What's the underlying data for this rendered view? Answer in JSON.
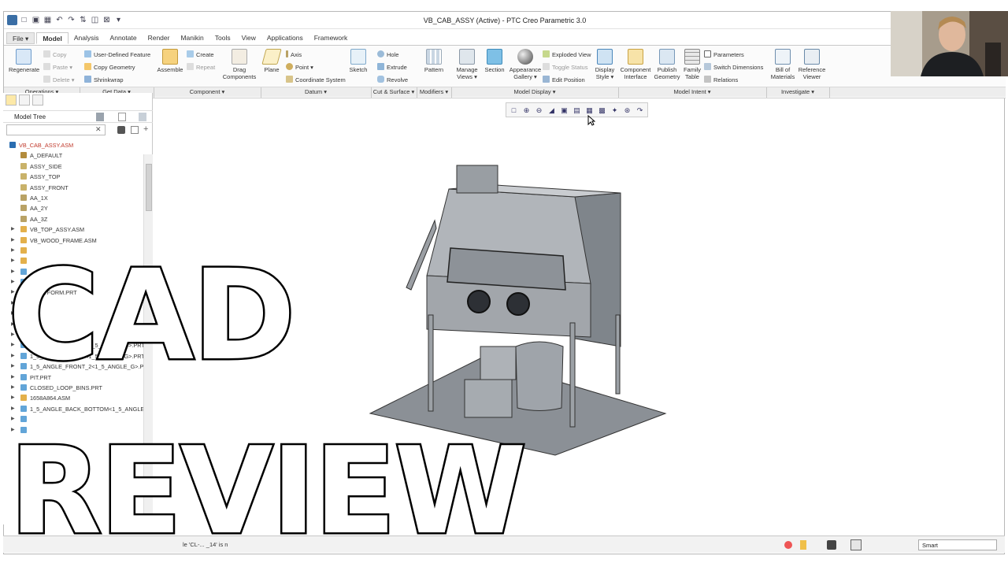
{
  "window": {
    "title": "VB_CAB_ASSY (Active) - PTC Creo Parametric 3.0"
  },
  "tabs": [
    {
      "label": "File ▾"
    },
    {
      "label": "Model"
    },
    {
      "label": "Analysis"
    },
    {
      "label": "Annotate"
    },
    {
      "label": "Render"
    },
    {
      "label": "Manikin"
    },
    {
      "label": "Tools"
    },
    {
      "label": "View"
    },
    {
      "label": "Applications"
    },
    {
      "label": "Framework"
    }
  ],
  "ribbon": {
    "regenerate": "Regenerate",
    "copy": "Copy",
    "paste": "Paste ▾",
    "delete": "Delete ▾",
    "user_defined_feature": "User-Defined Feature",
    "copy_geometry": "Copy Geometry",
    "shrinkwrap": "Shrinkwrap",
    "assemble": "Assemble",
    "create": "Create",
    "repeat": "Repeat",
    "drag_components_1": "Drag",
    "drag_components_2": "Components",
    "plane": "Plane",
    "axis": "Axis",
    "point": "Point ▾",
    "coordinate_system": "Coordinate System",
    "sketch": "Sketch",
    "hole": "Hole",
    "extrude": "Extrude",
    "revolve": "Revolve",
    "pattern": "Pattern",
    "manage_views_1": "Manage",
    "manage_views_2": "Views ▾",
    "section": "Section",
    "appearance_gallery_1": "Appearance",
    "appearance_gallery_2": "Gallery ▾",
    "exploded_view": "Exploded View",
    "toggle_status": "Toggle Status",
    "edit_position": "Edit Position",
    "display_style_1": "Display",
    "display_style_2": "Style ▾",
    "component_interface_1": "Component",
    "component_interface_2": "Interface",
    "publish_geometry_1": "Publish",
    "publish_geometry_2": "Geometry",
    "family_table_1": "Family",
    "family_table_2": "Table",
    "parameters": "Parameters",
    "switch_dimensions": "Switch Dimensions",
    "relations": "Relations",
    "bill_of_materials_1": "Bill of",
    "bill_of_materials_2": "Materials",
    "reference_viewer_1": "Reference",
    "reference_viewer_2": "Viewer"
  },
  "groups": [
    {
      "label": "Operations ▾"
    },
    {
      "label": "Get Data ▾"
    },
    {
      "label": "Component ▾"
    },
    {
      "label": "Datum ▾"
    },
    {
      "label": "Cut & Surface ▾"
    },
    {
      "label": "Modifiers ▾"
    },
    {
      "label": "Model Display ▾"
    },
    {
      "label": "Model Intent ▾"
    },
    {
      "label": "Investigate ▾"
    }
  ],
  "model_tree": {
    "title": "Model Tree",
    "items": [
      {
        "label": "VB_CAB_ASSY.ASM",
        "kind": "root"
      },
      {
        "label": "A_DEFAULT",
        "kind": "csys"
      },
      {
        "label": "ASSY_SIDE",
        "kind": "plane"
      },
      {
        "label": "ASSY_TOP",
        "kind": "plane"
      },
      {
        "label": "ASSY_FRONT",
        "kind": "plane"
      },
      {
        "label": "AA_1X",
        "kind": "axis"
      },
      {
        "label": "AA_2Y",
        "kind": "axis"
      },
      {
        "label": "AA_3Z",
        "kind": "axis"
      },
      {
        "label": "VB_TOP_ASSY.ASM",
        "kind": "asm"
      },
      {
        "label": "VB_WOOD_FRAME.ASM",
        "kind": "asm"
      },
      {
        "label": "",
        "kind": "asm"
      },
      {
        "label": "",
        "kind": "asm"
      },
      {
        "label": "",
        "kind": "part"
      },
      {
        "label": "",
        "kind": "part"
      },
      {
        "label": "_PLATFORM.PRT",
        "kind": "part"
      },
      {
        "label": "",
        "kind": "part"
      },
      {
        "label": "",
        "kind": "part"
      },
      {
        "label": "",
        "kind": "part"
      },
      {
        "label": "",
        "kind": "part"
      },
      {
        "label": "1_5_ANGLE_FRONT<1_5_ANGLE_G>.PRT",
        "kind": "part"
      },
      {
        "label": "1_5_ANGLE_FRONT<1_5_ANGLE_G>.PRT",
        "kind": "part"
      },
      {
        "label": "1_5_ANGLE_FRONT_2<1_5_ANGLE_G>.PRT",
        "kind": "part"
      },
      {
        "label": "PIT.PRT",
        "kind": "part"
      },
      {
        "label": "CLOSED_LOOP_BINS.PRT",
        "kind": "part"
      },
      {
        "label": "1658A864.ASM",
        "kind": "asm"
      },
      {
        "label": "1_5_ANGLE_BACK_BOTTOM<1_5_ANGLE_G",
        "kind": "part"
      },
      {
        "label": "",
        "kind": "part"
      },
      {
        "label": "",
        "kind": "part"
      }
    ]
  },
  "status": {
    "message": "le 'CL-... _14' is n",
    "selection_filter": "Smart"
  },
  "overlay": {
    "line1": "CAD",
    "line2": "REVIEW"
  },
  "colors": {
    "accent": "#2a6db0",
    "model_fill": "#9ea3a9",
    "model_dark": "#5b6066",
    "base_plate": "#8b9096"
  }
}
